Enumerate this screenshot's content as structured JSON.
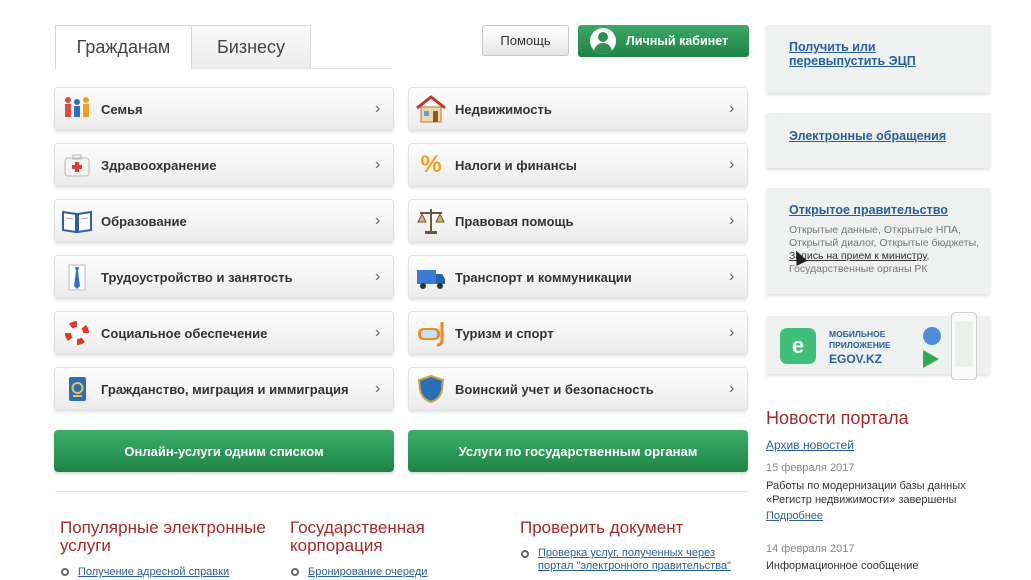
{
  "tabs": [
    {
      "label": "Гражданам",
      "active": true
    },
    {
      "label": "Бизнесу",
      "active": false
    }
  ],
  "header": {
    "help_label": "Помощь",
    "cabinet_label": "Личный кабинет"
  },
  "categories_left": [
    {
      "label": "Семья",
      "icon": "family-icon"
    },
    {
      "label": "Здравоохранение",
      "icon": "first-aid-kit-icon"
    },
    {
      "label": "Образование",
      "icon": "book-icon"
    },
    {
      "label": "Трудоустройство и занятость",
      "icon": "tie-shirt-icon"
    },
    {
      "label": "Социальное обеспечение",
      "icon": "lifebuoy-icon"
    },
    {
      "label": "Гражданство, миграция и иммиграция",
      "icon": "passport-icon"
    }
  ],
  "categories_right": [
    {
      "label": "Недвижимость",
      "icon": "house-icon"
    },
    {
      "label": "Налоги и финансы",
      "icon": "percent-icon"
    },
    {
      "label": "Правовая помощь",
      "icon": "scales-icon"
    },
    {
      "label": "Транспорт и коммуникации",
      "icon": "truck-icon"
    },
    {
      "label": "Туризм и спорт",
      "icon": "diving-mask-icon"
    },
    {
      "label": "Воинский учет и безопасность",
      "icon": "shield-icon"
    }
  ],
  "buttons": {
    "online_services": "Онлайн-услуги одним списком",
    "gov_services": "Услуги по государственным органам"
  },
  "sections": {
    "popular_title": "Популярные электронные услуги",
    "popular_link": "Получение адресной справки",
    "corp_title": "Государственная корпорация",
    "corp_link": "Бронирование очереди",
    "check_title": "Проверить документ",
    "check_link": "Проверка услуг, полученных через портал \"электронного правительства\""
  },
  "sidebar": {
    "ecp_link": "Получить или перевыпустить ЭЦП",
    "appeals_link": "Электронные обращения",
    "open_gov_link": "Открытое правительство",
    "open_gov_text_1": "Открытые данные, Открытые НПА, Открытый диалог, Открытые бюджеты,",
    "open_gov_underlined": "Запись на прием к министру",
    "open_gov_text_2": ", Государственные органы РК",
    "mobile_line1": "МОБИЛЬНОЕ",
    "mobile_line2": "ПРИЛОЖЕНИЕ",
    "mobile_name": "EGOV.KZ"
  },
  "news": {
    "title": "Новости портала",
    "archive": "Архив новостей",
    "items": [
      {
        "date": "15 февраля 2017",
        "text": "Работы по модернизации базы данных «Регистр недвижимости» завершены",
        "more": "Подробнее"
      },
      {
        "date": "14 февраля 2017",
        "text": "Информационное сообщение"
      }
    ]
  }
}
